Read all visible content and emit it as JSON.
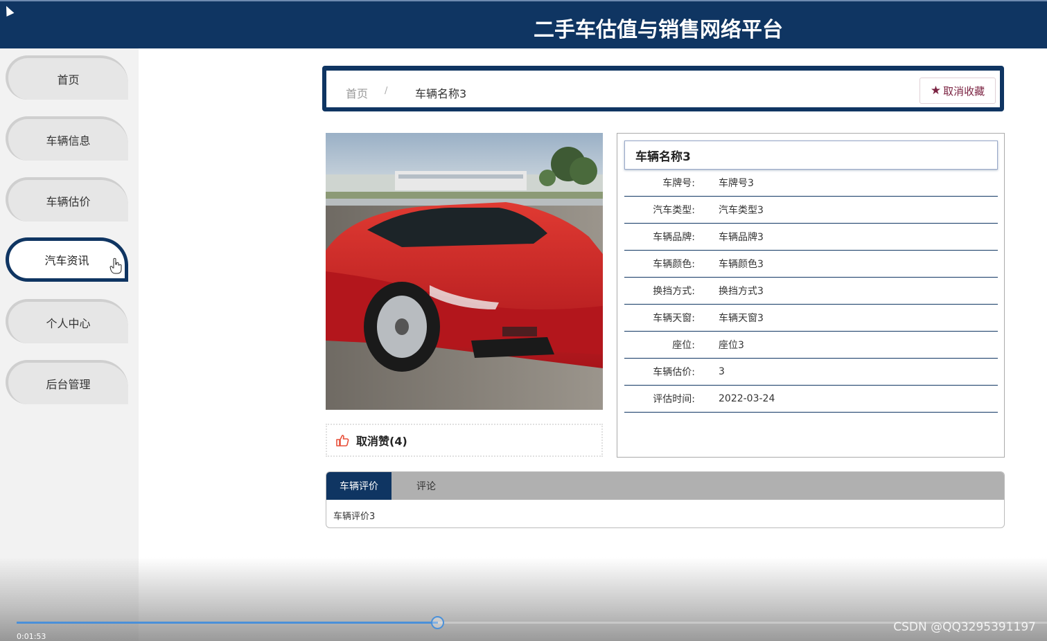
{
  "header": {
    "title": "二手车估值与销售网络平台"
  },
  "sidebar": {
    "items": [
      {
        "label": "首页"
      },
      {
        "label": "车辆信息"
      },
      {
        "label": "车辆估价"
      },
      {
        "label": "汽车资讯"
      },
      {
        "label": "个人中心"
      },
      {
        "label": "后台管理"
      }
    ],
    "active_index": 3
  },
  "breadcrumb": {
    "home": "首页",
    "separator": "/",
    "current": "车辆名称3"
  },
  "favorite_button": {
    "icon": "star-icon",
    "label": "取消收藏"
  },
  "like": {
    "icon": "thumbs-up-icon",
    "label": "取消赞(4)"
  },
  "detail": {
    "title": "车辆名称3",
    "rows": [
      {
        "label": "车牌号:",
        "value": "车牌号3"
      },
      {
        "label": "汽车类型:",
        "value": "汽车类型3"
      },
      {
        "label": "车辆品牌:",
        "value": "车辆品牌3"
      },
      {
        "label": "车辆颜色:",
        "value": "车辆颜色3"
      },
      {
        "label": "换挡方式:",
        "value": "换挡方式3"
      },
      {
        "label": "车辆天窗:",
        "value": "车辆天窗3"
      },
      {
        "label": "座位:",
        "value": "座位3"
      },
      {
        "label": "车辆估价:",
        "value": "3"
      },
      {
        "label": "评估时间:",
        "value": "2022-03-24"
      }
    ]
  },
  "tabs": {
    "items": [
      {
        "label": "车辆评价"
      },
      {
        "label": "评论"
      }
    ],
    "active_index": 0,
    "content": "车辆评价3"
  },
  "video": {
    "time": "0:01:53",
    "progress": 0.4,
    "watermark": "CSDN @QQ3295391197"
  },
  "colors": {
    "primary": "#0f3562",
    "accent_red": "#7b2342",
    "progress": "#4a90d9"
  }
}
